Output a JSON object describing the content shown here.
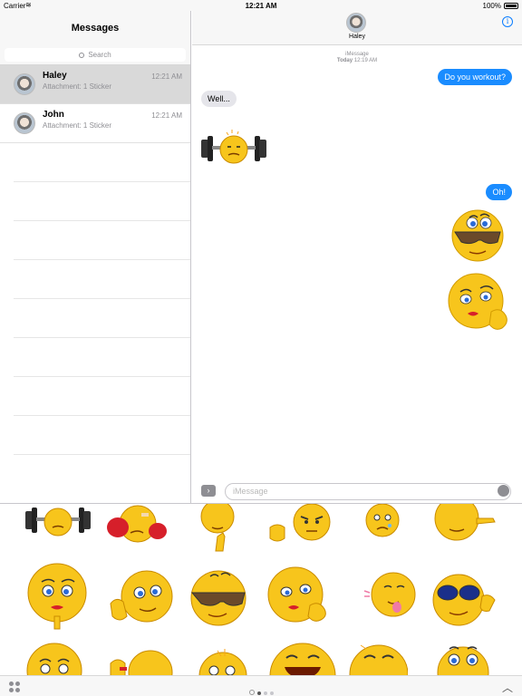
{
  "status_bar": {
    "carrier": "Carrier",
    "time": "12:21 AM",
    "battery": "100%"
  },
  "sidebar": {
    "title": "Messages",
    "search_placeholder": "Search",
    "conversations": [
      {
        "name": "Haley",
        "preview": "Attachment: 1 Sticker",
        "time": "12:21 AM",
        "selected": true
      },
      {
        "name": "John",
        "preview": "Attachment: 1 Sticker",
        "time": "12:21 AM",
        "selected": false
      }
    ]
  },
  "chat": {
    "contact_name": "Haley",
    "service": "iMessage",
    "timestamp_day": "Today",
    "timestamp_time": "12:19 AM",
    "messages": [
      {
        "direction": "out",
        "text": "Do you workout?"
      },
      {
        "direction": "in",
        "text": "Well..."
      },
      {
        "direction": "in",
        "sticker": "barbell-lifter-emoji"
      },
      {
        "direction": "out",
        "text": "Oh!"
      },
      {
        "direction": "out",
        "sticker": "sunglasses-emoji"
      },
      {
        "direction": "out",
        "sticker": "flirty-lipstick-emoji"
      }
    ],
    "composer_placeholder": "iMessage"
  },
  "sticker_drawer": {
    "stickers": [
      "barbell-emoji",
      "boxing-emoji",
      "thumbs-up-emoji",
      "angry-thumbs-emoji",
      "worried-emoji",
      "pointing-emoji",
      "lipstick-thinking-emoji",
      "ok-hand-emoji",
      "sunglasses-emoji",
      "flirty-lipstick-emoji",
      "tongue-out-emoji",
      "blue-glasses-emoji",
      "pointing-finger-emoji",
      "wave-emoji",
      "pointing-up-emoji",
      "laughing-emoji",
      "grinning-emoji",
      "shocked-emoji"
    ],
    "active_page": 1,
    "page_count": 3
  },
  "colors": {
    "accent": "#1a8cff",
    "emoji": "#f7c51c"
  }
}
